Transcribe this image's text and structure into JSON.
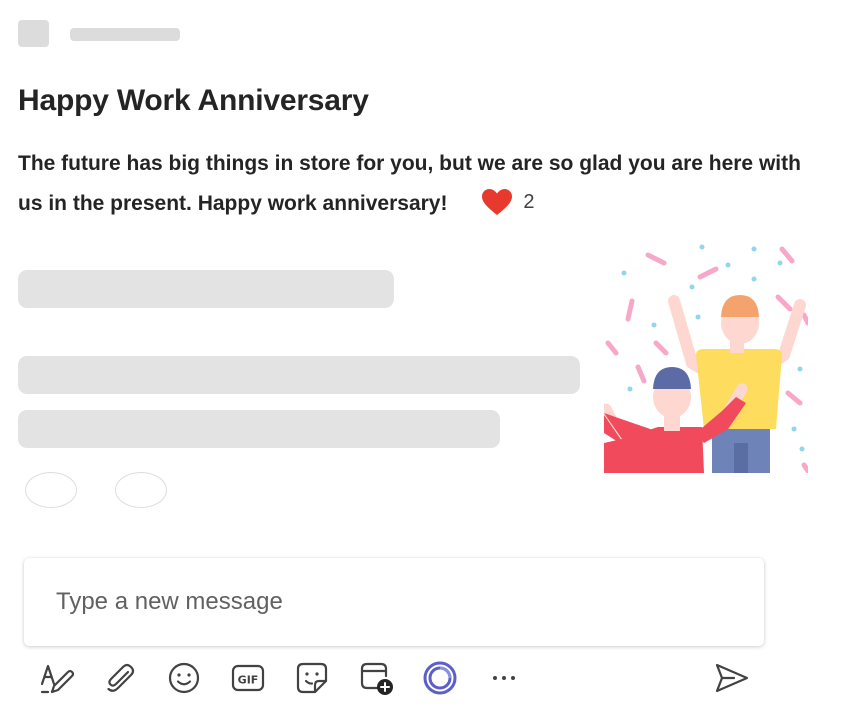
{
  "post": {
    "title": "Happy Work Anniversary",
    "message": "The future has big things in store for you, but we are so glad you are here with us in the present. Happy work anniversary!",
    "reaction": {
      "icon": "heart-icon",
      "count": "2",
      "color": "#e8392f"
    }
  },
  "composer": {
    "placeholder": "Type a new message"
  },
  "toolbar": {
    "items": [
      {
        "name": "format",
        "icon": "format-text-icon"
      },
      {
        "name": "attach",
        "icon": "paperclip-icon"
      },
      {
        "name": "emoji",
        "icon": "emoji-icon"
      },
      {
        "name": "gif",
        "icon": "gif-icon",
        "label": "GIF"
      },
      {
        "name": "sticker",
        "icon": "sticker-icon"
      },
      {
        "name": "schedule-meeting",
        "icon": "calendar-add-icon"
      },
      {
        "name": "loop",
        "icon": "loop-icon",
        "color": "#5b5fc7"
      },
      {
        "name": "more",
        "icon": "more-icon"
      },
      {
        "name": "send",
        "icon": "send-icon"
      }
    ]
  },
  "colors": {
    "skeleton": "#e3e3e3",
    "text": "#242424",
    "accent": "#5b5fc7"
  }
}
